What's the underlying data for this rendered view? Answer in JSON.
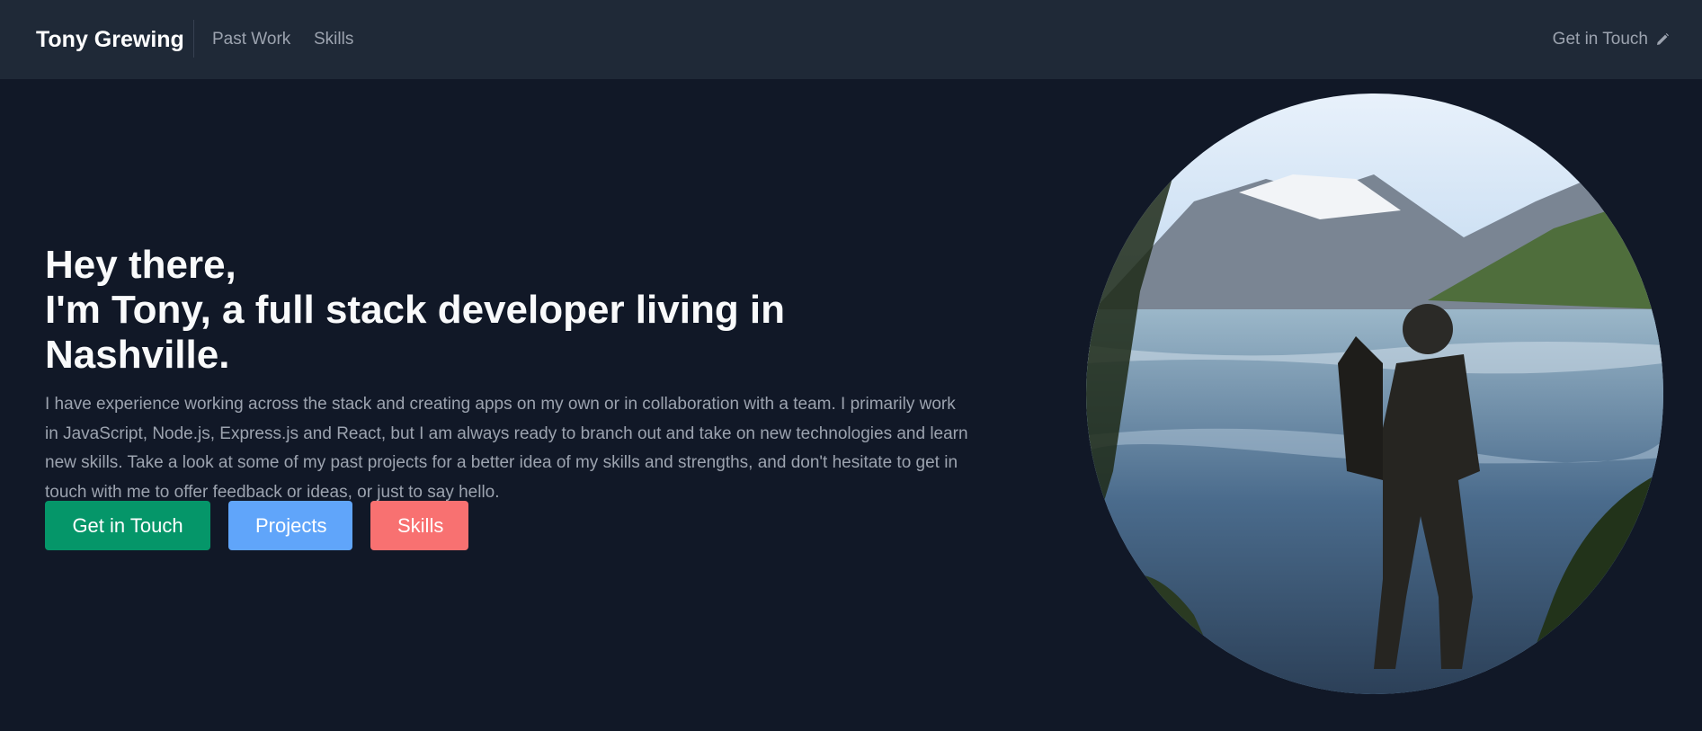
{
  "nav": {
    "brand": "Tony Grewing",
    "links": [
      "Past Work",
      "Skills"
    ],
    "contact_label": "Get in Touch",
    "contact_icon": "pencil-icon"
  },
  "hero": {
    "heading_line1": "Hey there,",
    "heading_line2": "I'm Tony, a full stack developer living in Nashville.",
    "body": "I have experience working across the stack and creating apps on my own or in collaboration with a team. I primarily work in JavaScript, Node.js, Express.js and React, but I am always ready to branch out and take on new technologies and learn new skills. Take a look at some of my past projects for a better idea of my skills and strengths, and don't hesitate to get in touch with me to offer feedback or ideas, or just to say hello.",
    "buttons": {
      "contact": "Get in Touch",
      "projects": "Projects",
      "skills": "Skills"
    }
  },
  "colors": {
    "background": "#111827",
    "navbar": "#1f2937",
    "contact_button": "#059669",
    "projects_button": "#60a5fa",
    "skills_button": "#f87171"
  }
}
